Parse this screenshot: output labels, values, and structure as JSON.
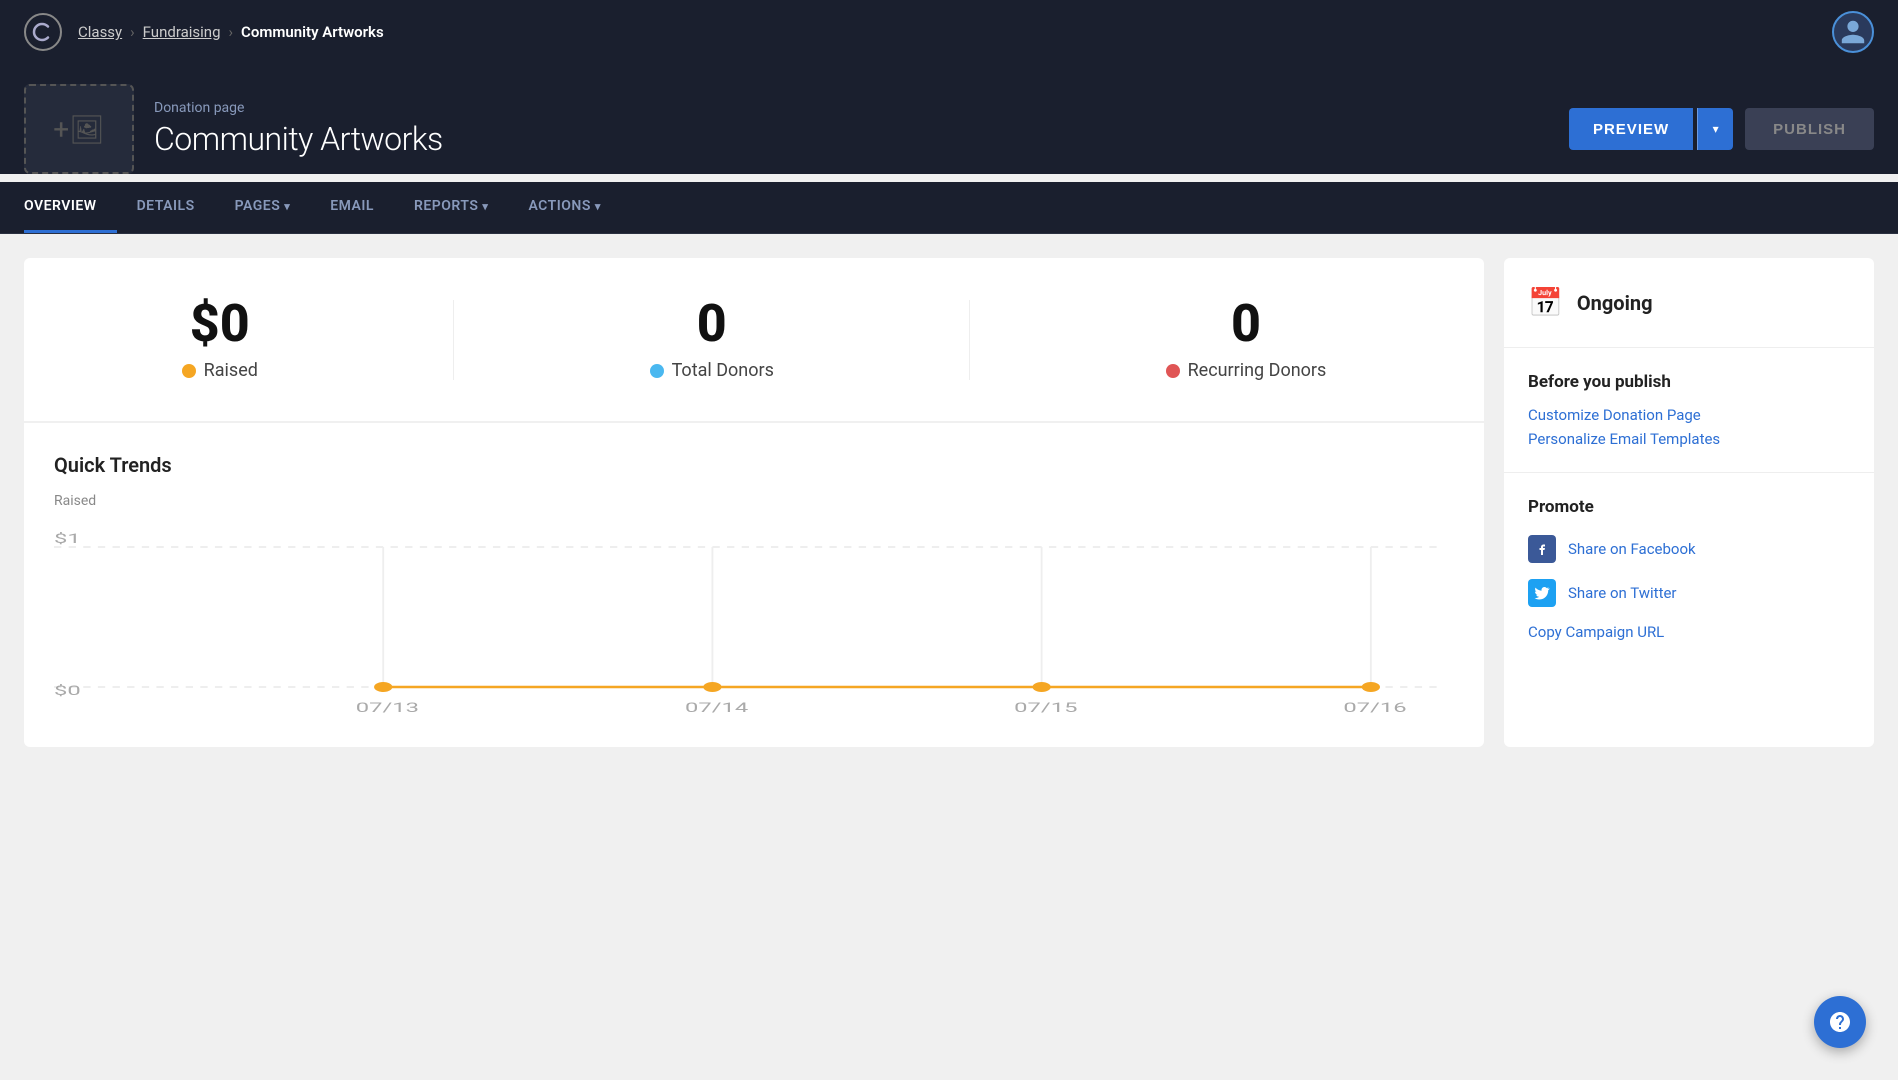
{
  "topNav": {
    "logo": "Cl",
    "breadcrumb": {
      "items": [
        "Classy",
        "Fundraising",
        "Community Artworks"
      ]
    }
  },
  "pageHeader": {
    "pageType": "Donation page",
    "pageTitle": "Community Artworks",
    "previewLabel": "PREVIEW",
    "publishLabel": "PUBLISH"
  },
  "tabs": [
    {
      "label": "OVERVIEW",
      "active": true,
      "hasDropdown": false
    },
    {
      "label": "DETAILS",
      "active": false,
      "hasDropdown": false
    },
    {
      "label": "PAGES",
      "active": false,
      "hasDropdown": true
    },
    {
      "label": "EMAIL",
      "active": false,
      "hasDropdown": false
    },
    {
      "label": "REPORTS",
      "active": false,
      "hasDropdown": true
    },
    {
      "label": "ACTIONS",
      "active": false,
      "hasDropdown": true
    }
  ],
  "stats": {
    "raised": {
      "value": "$0",
      "label": "Raised",
      "dotClass": "dot-orange"
    },
    "totalDonors": {
      "value": "0",
      "label": "Total Donors",
      "dotClass": "dot-blue"
    },
    "recurringDonors": {
      "value": "0",
      "label": "Recurring Donors",
      "dotClass": "dot-red"
    }
  },
  "quickTrends": {
    "title": "Quick Trends",
    "chartLabel": "Raised",
    "yAxisMax": "$1",
    "yAxisMin": "$0",
    "xAxisDates": [
      "07/13",
      "07/14",
      "07/15",
      "07/16"
    ],
    "lineColor": "#f5a623"
  },
  "rightPanel": {
    "status": "Ongoing",
    "beforePublish": {
      "title": "Before you publish",
      "links": [
        "Customize Donation Page",
        "Personalize Email Templates"
      ]
    },
    "promote": {
      "title": "Promote",
      "items": [
        {
          "label": "Share on Facebook",
          "icon": "fb"
        },
        {
          "label": "Share on Twitter",
          "icon": "tw"
        },
        {
          "label": "Copy Campaign URL",
          "icon": null
        }
      ]
    }
  }
}
